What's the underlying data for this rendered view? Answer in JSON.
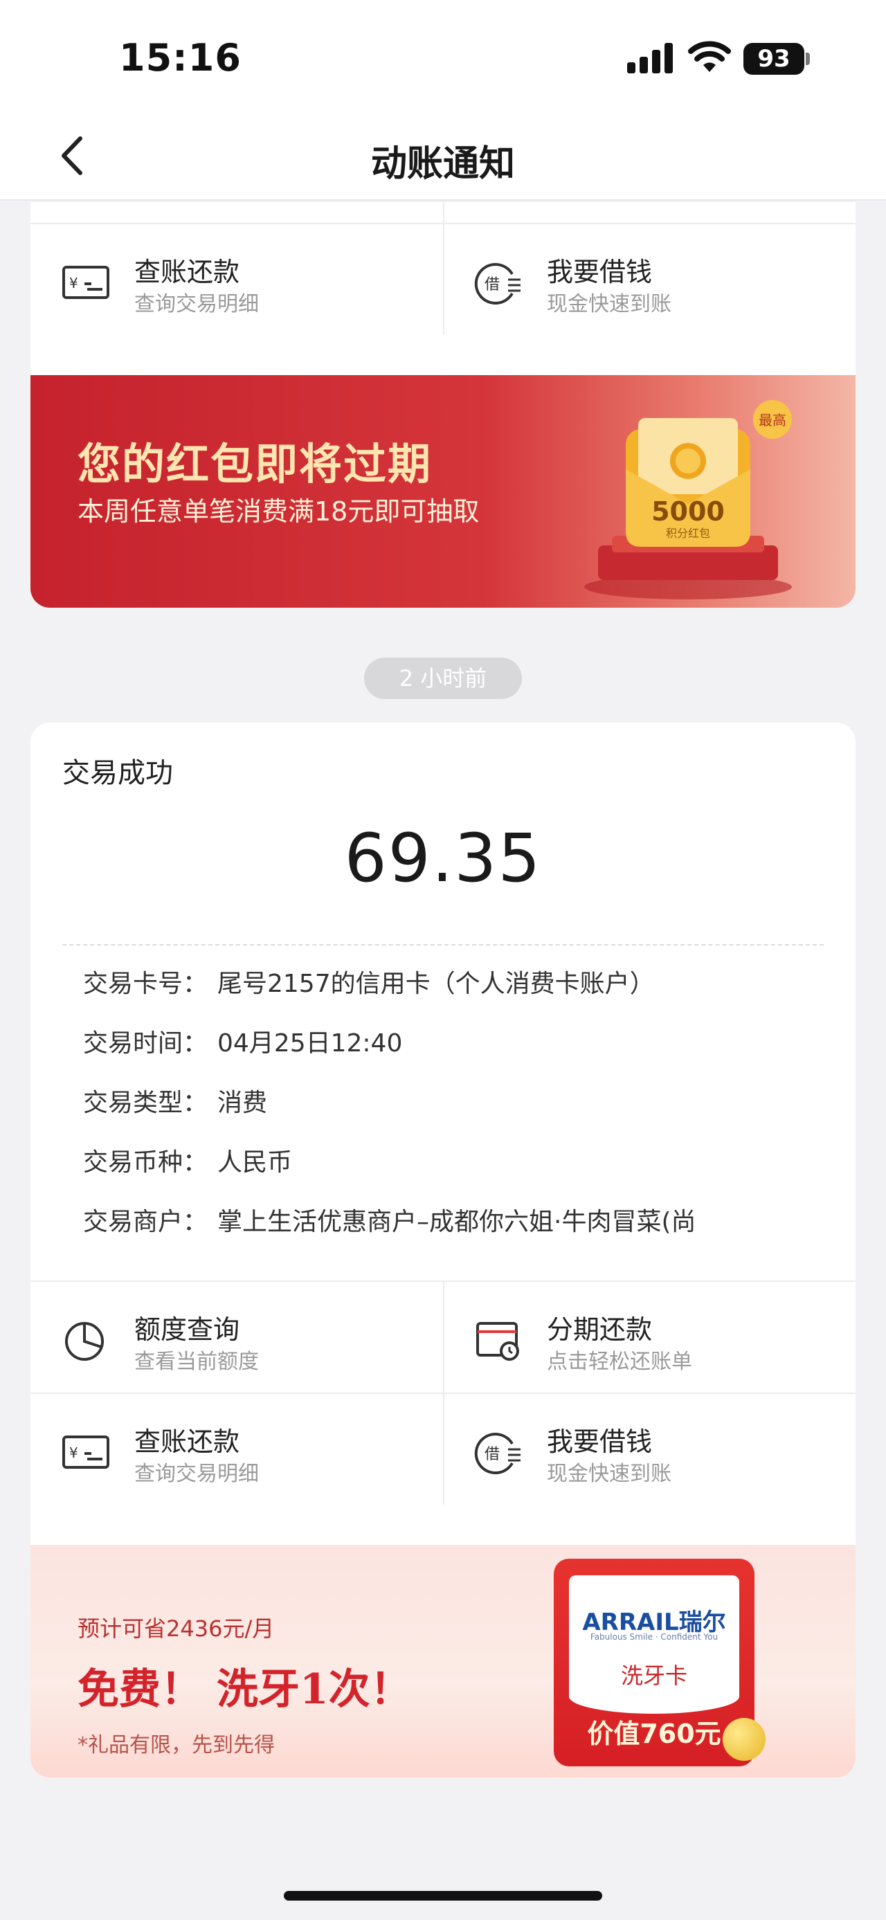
{
  "status_bar": {
    "time": "15:16",
    "battery": "93"
  },
  "nav": {
    "title": "动账通知"
  },
  "actions_top": [
    {
      "title": "查账还款",
      "sub": "查询交易明细",
      "icon": "bill-repay-icon"
    },
    {
      "title": "我要借钱",
      "sub": "现金快速到账",
      "icon": "borrow-icon"
    }
  ],
  "banner1": {
    "title": "您的红包即将过期",
    "subtitle": "本周任意单笔消费满18元即可抽取",
    "badge": "最高",
    "amount": "5000",
    "amount_label": "积分红包"
  },
  "time_pill": "2 小时前",
  "transaction": {
    "status": "交易成功",
    "amount": "69.35",
    "rows": [
      {
        "label": "交易卡号：",
        "value": "尾号2157的信用卡（个人消费卡账户）"
      },
      {
        "label": "交易时间：",
        "value": "04月25日12:40"
      },
      {
        "label": "交易类型：",
        "value": "消费"
      },
      {
        "label": "交易币种：",
        "value": "人民币"
      },
      {
        "label": "交易商户：",
        "value": "掌上生活优惠商户–成都你六姐·牛肉冒菜(尚"
      }
    ]
  },
  "actions_bottom": [
    {
      "title": "额度查询",
      "sub": "查看当前额度",
      "icon": "pie-chart-icon"
    },
    {
      "title": "分期还款",
      "sub": "点击轻松还账单",
      "icon": "installment-icon"
    },
    {
      "title": "查账还款",
      "sub": "查询交易明细",
      "icon": "bill-repay-icon"
    },
    {
      "title": "我要借钱",
      "sub": "现金快速到账",
      "icon": "borrow-icon"
    }
  ],
  "banner2": {
    "pre": "预计可省2436元/月",
    "title": "免费！ 洗牙1次！",
    "note": "*礼品有限，先到先得",
    "brand": "ARRAIL瑞尔",
    "brand_tagline": "Fabulous Smile · Confident You",
    "card_label": "洗牙卡",
    "card_value": "价值760元"
  }
}
